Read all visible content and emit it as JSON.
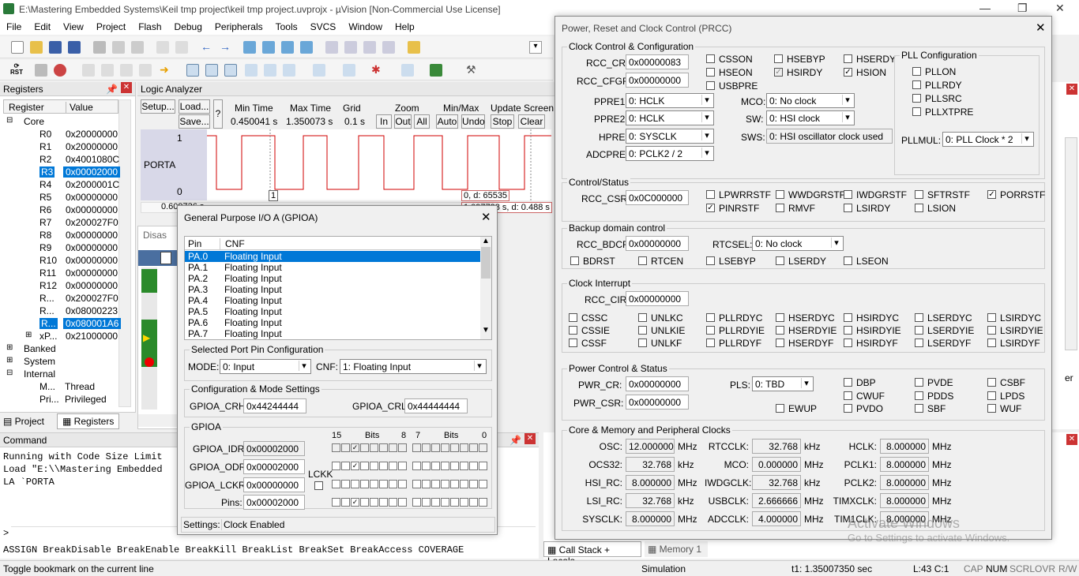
{
  "app": {
    "title": "E:\\Mastering Embedded Systems\\Keil tmp project\\keil tmp project.uvprojx - µVision  [Non-Commercial Use License]"
  },
  "menu": [
    "File",
    "Edit",
    "View",
    "Project",
    "Flash",
    "Debug",
    "Peripherals",
    "Tools",
    "SVCS",
    "Window",
    "Help"
  ],
  "registers": {
    "title": "Registers",
    "col_register": "Register",
    "col_value": "Value",
    "core": "Core",
    "rows": [
      [
        "R0",
        "0x20000000"
      ],
      [
        "R1",
        "0x20000000"
      ],
      [
        "R2",
        "0x4001080C"
      ],
      [
        "R3",
        "0x00002000"
      ],
      [
        "R4",
        "0x2000001C"
      ],
      [
        "R5",
        "0x00000000"
      ],
      [
        "R6",
        "0x00000000"
      ],
      [
        "R7",
        "0x200027F0"
      ],
      [
        "R8",
        "0x00000000"
      ],
      [
        "R9",
        "0x00000000"
      ],
      [
        "R10",
        "0x00000000"
      ],
      [
        "R11",
        "0x00000000"
      ],
      [
        "R12",
        "0x00000000"
      ],
      [
        "R...",
        "0x200027F0"
      ],
      [
        "R...",
        "0x08000223"
      ],
      [
        "R...",
        "0x080001A6"
      ],
      [
        "xP...",
        "0x21000000"
      ]
    ],
    "banked": "Banked",
    "system": "System",
    "internal": "Internal",
    "mode_k": "M...",
    "mode_v": "Thread",
    "priv_k": "Pri...",
    "priv_v": "Privileged",
    "tab_project": "Project",
    "tab_registers": "Registers"
  },
  "logic": {
    "title": "Logic Analyzer",
    "setup": "Setup...",
    "load": "Load...",
    "save": "Save...",
    "q": "?",
    "min_time_l": "Min Time",
    "min_time": "0.450041 s",
    "max_time_l": "Max Time",
    "max_time": "1.350073 s",
    "grid_l": "Grid",
    "grid": "0.1 s",
    "zoom_l": "Zoom",
    "zin": "In",
    "zout": "Out",
    "zall": "All",
    "minmax_l": "Min/Max",
    "auto": "Auto",
    "undo": "Undo",
    "update_l": "Update Screen",
    "stop": "Stop",
    "clear": "Clear",
    "signal": "PORTA",
    "y1": "1",
    "y0": "0",
    "marker": "1",
    "d_label": "0,  d: 65535",
    "t_left": "0.609736 s",
    "t_right": "1.097738 s,  d: 0.488 s",
    "disas": "Disas"
  },
  "command": {
    "title": "Command",
    "lines": [
      "Running with Code Size Limit",
      "Load \"E:\\\\Mastering Embedded",
      "LA `PORTA"
    ],
    "prompt": ">",
    "hint": "ASSIGN BreakDisable BreakEnable BreakKill BreakList BreakSet BreakAccess COVERAGE"
  },
  "tabs_bottom": {
    "callstack": "Call Stack + Locals",
    "memory": "Memory 1"
  },
  "gpio": {
    "title": "General Purpose I/O A (GPIOA)",
    "col_pin": "Pin",
    "col_cnf": "CNF",
    "pins": [
      [
        "PA.0",
        "Floating Input"
      ],
      [
        "PA.1",
        "Floating Input"
      ],
      [
        "PA.2",
        "Floating Input"
      ],
      [
        "PA.3",
        "Floating Input"
      ],
      [
        "PA.4",
        "Floating Input"
      ],
      [
        "PA.5",
        "Floating Input"
      ],
      [
        "PA.6",
        "Floating Input"
      ],
      [
        "PA.7",
        "Floating Input"
      ]
    ],
    "sel_title": "Selected Port Pin Configuration",
    "mode_l": "MODE:",
    "mode": "0: Input",
    "cnf_l": "CNF:",
    "cnf": "1: Floating Input",
    "cfg_title": "Configuration & Mode Settings",
    "crh_l": "GPIOA_CRH:",
    "crh": "0x44244444",
    "crl_l": "GPIOA_CRL:",
    "crl": "0x44444444",
    "grp": "GPIOA",
    "idr_l": "GPIOA_IDR:",
    "idr": "0x00002000",
    "odr_l": "GPIOA_ODR:",
    "odr": "0x00002000",
    "lckr_l": "GPIOA_LCKR:",
    "lckr": "0x00000000",
    "pins_l": "Pins:",
    "pinsv": "0x00002000",
    "lckk": "LCKK",
    "b15": "15",
    "bits1": "Bits",
    "b8": "8",
    "b7": "7",
    "bits2": "Bits",
    "b0": "0",
    "settings": "Settings:",
    "settings_v": "Clock Enabled"
  },
  "prcc": {
    "title": "Power, Reset and Clock Control (PRCC)",
    "cc_title": "Clock Control & Configuration",
    "rcc_cr_l": "RCC_CR:",
    "rcc_cr": "0x00000083",
    "rcc_cfgr_l": "RCC_CFGR:",
    "rcc_cfgr": "0x00000000",
    "csson": "CSSON",
    "hsebyp": "HSEBYP",
    "hserdy": "HSERDY",
    "hseon": "HSEON",
    "hsirdy": "HSIRDY",
    "hsion": "HSION",
    "usbpre": "USBPRE",
    "ppre1_l": "PPRE1:",
    "ppre1": "0: HCLK",
    "ppre2_l": "PPRE2:",
    "ppre2": "0: HCLK",
    "hpre_l": "HPRE:",
    "hpre": "0: SYSCLK",
    "adcpre_l": "ADCPRE:",
    "adcpre": "0: PCLK2 / 2",
    "mco_l": "MCO:",
    "mco": "0: No clock",
    "sw_l": "SW:",
    "sw": "0: HSI clock",
    "sws_l": "SWS:",
    "sws": "0: HSI oscillator clock used",
    "pll_title": "PLL Configuration",
    "pllon": "PLLON",
    "pllrdy": "PLLRDY",
    "pllsrc": "PLLSRC",
    "pllxtpre": "PLLXTPRE",
    "pllmul_l": "PLLMUL:",
    "pllmul": "0: PLL Clock * 2",
    "cs_title": "Control/Status",
    "rcc_csr_l": "RCC_CSR:",
    "rcc_csr": "0x0C000000",
    "cs_flags": [
      "LPWRRSTF",
      "WWDGRSTF",
      "IWDGRSTF",
      "SFTRSTF",
      "PORRSTF",
      "PINRSTF",
      "RMVF",
      "LSIRDY",
      "LSION"
    ],
    "bd_title": "Backup domain control",
    "rcc_bdcr_l": "RCC_BDCR:",
    "rcc_bdcr": "0x00000000",
    "rtcsel_l": "RTCSEL:",
    "rtcsel": "0: No clock",
    "bd_flags": [
      "BDRST",
      "RTCEN",
      "LSEBYP",
      "LSERDY",
      "LSEON"
    ],
    "ci_title": "Clock Interrupt",
    "rcc_cir_l": "RCC_CIR:",
    "rcc_cir": "0x00000000",
    "ci_flags": [
      [
        "CSSC",
        "UNLKC",
        "PLLRDYC",
        "HSERDYC",
        "HSIRDYC",
        "LSERDYC",
        "LSIRDYC"
      ],
      [
        "CSSIE",
        "UNLKIE",
        "PLLRDYIE",
        "HSERDYIE",
        "HSIRDYIE",
        "LSERDYIE",
        "LSIRDYIE"
      ],
      [
        "CSSF",
        "UNLKF",
        "PLLRDYF",
        "HSERDYF",
        "HSIRDYF",
        "LSERDYF",
        "LSIRDYF"
      ]
    ],
    "pc_title": "Power Control & Status",
    "pwr_cr_l": "PWR_CR:",
    "pwr_cr": "0x00000000",
    "pwr_csr_l": "PWR_CSR:",
    "pwr_csr": "0x00000000",
    "pls_l": "PLS:",
    "pls": "0: TBD",
    "pc_flags": [
      "DBP",
      "PVDE",
      "CSBF",
      "CWUF",
      "PDDS",
      "LPDS",
      "EWUP",
      "PVDO",
      "SBF",
      "WUF"
    ],
    "clk_title": "Core & Memory and Peripheral Clocks",
    "clocks": [
      [
        "OSC:",
        "12.000000",
        "MHz"
      ],
      [
        "RTCCLK:",
        "32.768",
        "kHz"
      ],
      [
        "HCLK:",
        "8.000000",
        "MHz"
      ],
      [
        "OCS32:",
        "32.768",
        "kHz"
      ],
      [
        "MCO:",
        "0.000000",
        "MHz"
      ],
      [
        "PCLK1:",
        "8.000000",
        "MHz"
      ],
      [
        "HSI_RC:",
        "8.000000",
        "MHz"
      ],
      [
        "IWDGCLK:",
        "32.768",
        "kHz"
      ],
      [
        "PCLK2:",
        "8.000000",
        "MHz"
      ],
      [
        "LSI_RC:",
        "32.768",
        "kHz"
      ],
      [
        "USBCLK:",
        "2.666666",
        "MHz"
      ],
      [
        "TIMXCLK:",
        "8.000000",
        "MHz"
      ],
      [
        "SYSCLK:",
        "8.000000",
        "MHz"
      ],
      [
        "ADCCLK:",
        "4.000000",
        "MHz"
      ],
      [
        "TIM1CLK:",
        "8.000000",
        "MHz"
      ]
    ]
  },
  "watermark": {
    "l1": "Activate Windows",
    "l2": "Go to Settings to activate Windows."
  },
  "right_fragment": "er",
  "status": {
    "left": "Toggle bookmark on the current line",
    "mode": "Simulation",
    "time": "t1: 1.35007350 sec",
    "pos": "L:43 C:1",
    "cap": "CAP",
    "num": "NUM",
    "scrl": "SCRL",
    "ovr": "OVR",
    "rw": "R/W"
  }
}
